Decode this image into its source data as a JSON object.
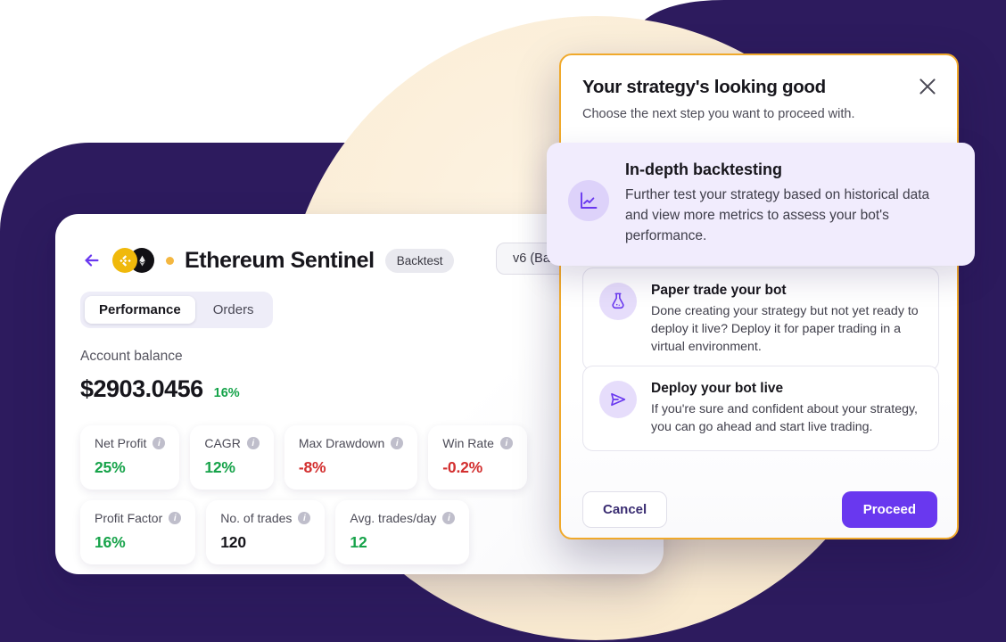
{
  "theme": {
    "brand_purple": "#6938EF",
    "dark_purple": "#2D1B5E",
    "cream": "#fbeed8",
    "accent_orange": "#F0A92B",
    "positive_green": "#17a34a",
    "negative_red": "#d33030"
  },
  "dashboard": {
    "back_icon": "arrow-left-icon",
    "coins": [
      {
        "name": "bnb-coin-icon",
        "symbol": "BNB"
      },
      {
        "name": "eth-coin-icon",
        "symbol": "ETH"
      }
    ],
    "status_dot": "active-status-dot",
    "title": "Ethereum Sentinel",
    "badge": "Backtest",
    "version_select": "v6 (Ba",
    "tabs": [
      {
        "label": "Performance",
        "active": true
      },
      {
        "label": "Orders",
        "active": false
      }
    ],
    "balance": {
      "label": "Account balance",
      "amount": "$2903.0456",
      "delta": "16%"
    },
    "metrics_row1": [
      {
        "label": "Net Profit",
        "value": "25%",
        "tone": "positive"
      },
      {
        "label": "CAGR",
        "value": "12%",
        "tone": "positive"
      },
      {
        "label": "Max Drawdown",
        "value": "-8%",
        "tone": "negative"
      },
      {
        "label": "Win Rate",
        "value": "-0.2%",
        "tone": "negative"
      }
    ],
    "metrics_row2": [
      {
        "label": "Profit Factor",
        "value": "16%",
        "tone": "positive"
      },
      {
        "label": "No. of trades",
        "value": "120",
        "tone": "neutral"
      },
      {
        "label": "Avg. trades/day",
        "value": "12",
        "tone": "positive"
      }
    ],
    "info_icon_glyph": "i"
  },
  "modal": {
    "title": "Your strategy's looking good",
    "subtitle": "Choose the next step you want to proceed with.",
    "close_icon": "close-icon",
    "options": [
      {
        "id": "in-depth-backtesting",
        "icon": "chart-line-icon",
        "title": "In-depth backtesting",
        "description": "Further test your strategy based on historical data and view more metrics to assess your bot's performance.",
        "highlighted": true
      },
      {
        "id": "paper-trade",
        "icon": "flask-icon",
        "title": "Paper trade your bot",
        "description": "Done creating your strategy but not yet ready to deploy it live? Deploy it for paper trading in a virtual environment.",
        "highlighted": false
      },
      {
        "id": "deploy-live",
        "icon": "send-icon",
        "title": "Deploy your bot live",
        "description": "If you're sure and confident about your strategy, you can go ahead and start live trading.",
        "highlighted": false
      }
    ],
    "cancel_label": "Cancel",
    "proceed_label": "Proceed"
  }
}
